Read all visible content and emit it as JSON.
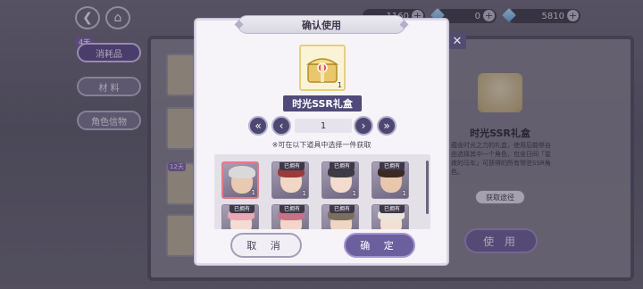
{
  "topbar": {
    "currency": [
      {
        "value": "1160",
        "icon": "coin-icon"
      },
      {
        "value": "0",
        "icon": "diamond-icon"
      },
      {
        "value": "5810",
        "icon": "gem-icon"
      }
    ]
  },
  "sidebar": {
    "badge": "4天",
    "tabs": [
      {
        "label": "消耗品",
        "active": true
      },
      {
        "label": "材 料",
        "active": false
      },
      {
        "label": "角色信物",
        "active": false
      }
    ]
  },
  "inventory": {
    "badge": "12天"
  },
  "detail": {
    "title": "时光SSR礼盒",
    "description": "蕴含时光之力的礼盒，使用后能够自由选择其中一个角色，包含日间「星夜的马车」可获得的所有常驻SSR角色。",
    "get_label": "获取途径",
    "use_label": "使 用"
  },
  "dialog": {
    "title": "确认使用",
    "item_name": "时光SSR礼盒",
    "item_count": "1",
    "quantity": "1",
    "hint": "※可在以下道具中选择一件获取",
    "cancel_label": "取 消",
    "confirm_label": "确 定",
    "characters": [
      {
        "owned": "",
        "count": "1",
        "selected": true,
        "hair": "#d9d9d9",
        "face": "#e8c9b2"
      },
      {
        "owned": "已拥有",
        "count": "1",
        "selected": false,
        "hair": "#9a3b3b",
        "face": "#f1d7c5"
      },
      {
        "owned": "已拥有",
        "count": "1",
        "selected": false,
        "hair": "#3c3c46",
        "face": "#f3dccb"
      },
      {
        "owned": "已拥有",
        "count": "1",
        "selected": false,
        "hair": "#3a2a22",
        "face": "#e9c7ac"
      },
      {
        "owned": "已拥有",
        "count": "",
        "selected": false,
        "hair": "#e7a9b6",
        "face": "#f5dcd2"
      },
      {
        "owned": "已拥有",
        "count": "",
        "selected": false,
        "hair": "#c47386",
        "face": "#f3d6c9"
      },
      {
        "owned": "已拥有",
        "count": "",
        "selected": false,
        "hair": "#7a6e5f",
        "face": "#efd6c3"
      },
      {
        "owned": "已拥有",
        "count": "",
        "selected": false,
        "hair": "#e9e6e0",
        "face": "#f4e0d2"
      }
    ]
  }
}
